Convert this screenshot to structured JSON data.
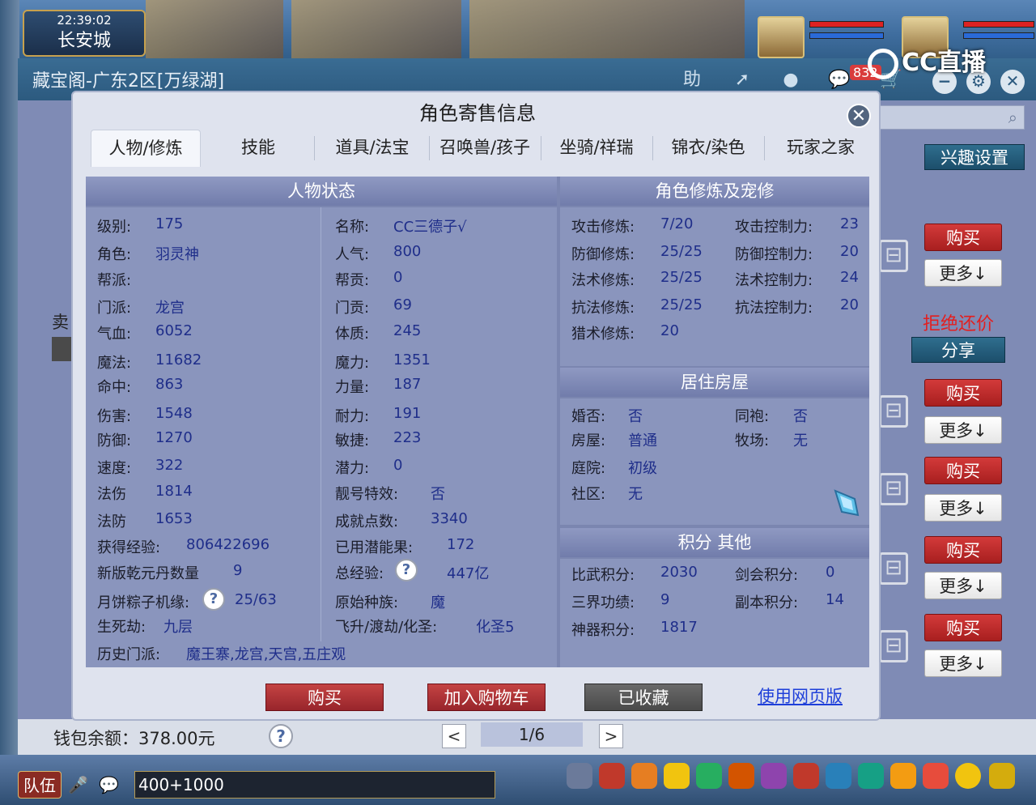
{
  "top": {
    "time": "22:39:02",
    "city": "长安城",
    "cc_logo": "CC直播",
    "badge_count": "832"
  },
  "window": {
    "title": "藏宝阁-广东2区[万绿湖]",
    "help_label": "助",
    "interest_button": "兴趣设置",
    "sell_label": "卖"
  },
  "sidebar": {
    "buy_label": "购买",
    "more_label": "更多↓",
    "reject_text": "拒绝还价",
    "share_label": "分享"
  },
  "bottom": {
    "wallet": "钱包余额：378.00元",
    "question": "?",
    "page": "1/6",
    "prev": "<",
    "next": ">"
  },
  "chat": {
    "team_label": "队伍",
    "input_value": "400+1000"
  },
  "modal": {
    "title": "角色寄售信息",
    "close": "✕",
    "tabs": [
      "人物/修炼",
      "技能",
      "道具/法宝",
      "召唤兽/孩子",
      "坐骑/祥瑞",
      "锦衣/染色",
      "玩家之家"
    ],
    "status_header": "人物状态",
    "cultivation_header": "角色修炼及宠修",
    "house_header": "居住房屋",
    "points_header": "积分 其他",
    "left_col": [
      {
        "label": "级别:",
        "value": "175"
      },
      {
        "label": "角色:",
        "value": "羽灵神"
      },
      {
        "label": "帮派:",
        "value": ""
      },
      {
        "label": "门派:",
        "value": "龙宫"
      },
      {
        "label": "气血:",
        "value": "6052"
      },
      {
        "label": "魔法:",
        "value": "11682"
      },
      {
        "label": "命中:",
        "value": "863"
      },
      {
        "label": "伤害:",
        "value": "1548"
      },
      {
        "label": "防御:",
        "value": "1270"
      },
      {
        "label": "速度:",
        "value": "322"
      },
      {
        "label": "法伤",
        "value": "1814"
      },
      {
        "label": "法防",
        "value": "1653"
      }
    ],
    "exp": {
      "label": "获得经验:",
      "value": "806422696"
    },
    "qianyuan": {
      "label": "新版乾元丹数量",
      "value": "9"
    },
    "zongzi": {
      "label": "月饼粽子机缘:",
      "value": "25/63"
    },
    "shengsi": {
      "label": "生死劫:",
      "value": "九层"
    },
    "history": {
      "label": "历史门派:",
      "value": "魔王寨,龙宫,天宫,五庄观"
    },
    "mid_col": [
      {
        "label": "名称:",
        "value": "CC三德子√"
      },
      {
        "label": "人气:",
        "value": "800"
      },
      {
        "label": "帮贡:",
        "value": "0"
      },
      {
        "label": "门贡:",
        "value": "69"
      },
      {
        "label": "体质:",
        "value": "245"
      },
      {
        "label": "魔力:",
        "value": "1351"
      },
      {
        "label": "力量:",
        "value": "187"
      },
      {
        "label": "耐力:",
        "value": "191"
      },
      {
        "label": "敏捷:",
        "value": "223"
      },
      {
        "label": "潜力:",
        "value": "0"
      }
    ],
    "liang": {
      "label": "靓号特效:",
      "value": "否"
    },
    "achievement": {
      "label": "成就点数:",
      "value": "3340"
    },
    "potential_fruit": {
      "label": "已用潜能果:",
      "value": "172"
    },
    "total_exp": {
      "label": "总经验:",
      "value": "447亿"
    },
    "origin": {
      "label": "原始种族:",
      "value": "魔"
    },
    "feisheng": {
      "label": "飞升/渡劫/化圣:",
      "value": "化圣5"
    },
    "cult_left": [
      {
        "label": "攻击修炼:",
        "value": "7/20"
      },
      {
        "label": "防御修炼:",
        "value": "25/25"
      },
      {
        "label": "法术修炼:",
        "value": "25/25"
      },
      {
        "label": "抗法修炼:",
        "value": "25/25"
      },
      {
        "label": "猎术修炼:",
        "value": "20"
      }
    ],
    "cult_right": [
      {
        "label": "攻击控制力:",
        "value": "23"
      },
      {
        "label": "防御控制力:",
        "value": "20"
      },
      {
        "label": "法术控制力:",
        "value": "24"
      },
      {
        "label": "抗法控制力:",
        "value": "20"
      }
    ],
    "house_left": [
      {
        "label": "婚否:",
        "value": "否"
      },
      {
        "label": "房屋:",
        "value": "普通"
      },
      {
        "label": "庭院:",
        "value": "初级"
      },
      {
        "label": "社区:",
        "value": "无"
      }
    ],
    "house_right": [
      {
        "label": "同袍:",
        "value": "否"
      },
      {
        "label": "牧场:",
        "value": "无"
      }
    ],
    "points_left": [
      {
        "label": "比武积分:",
        "value": "2030"
      },
      {
        "label": "三界功绩:",
        "value": "9"
      },
      {
        "label": "神器积分:",
        "value": "1817"
      }
    ],
    "points_right": [
      {
        "label": "剑会积分:",
        "value": "0"
      },
      {
        "label": "副本积分:",
        "value": "14"
      }
    ],
    "buy": "购买",
    "add_cart": "加入购物车",
    "collected": "已收藏",
    "web_version": "使用网页版"
  }
}
